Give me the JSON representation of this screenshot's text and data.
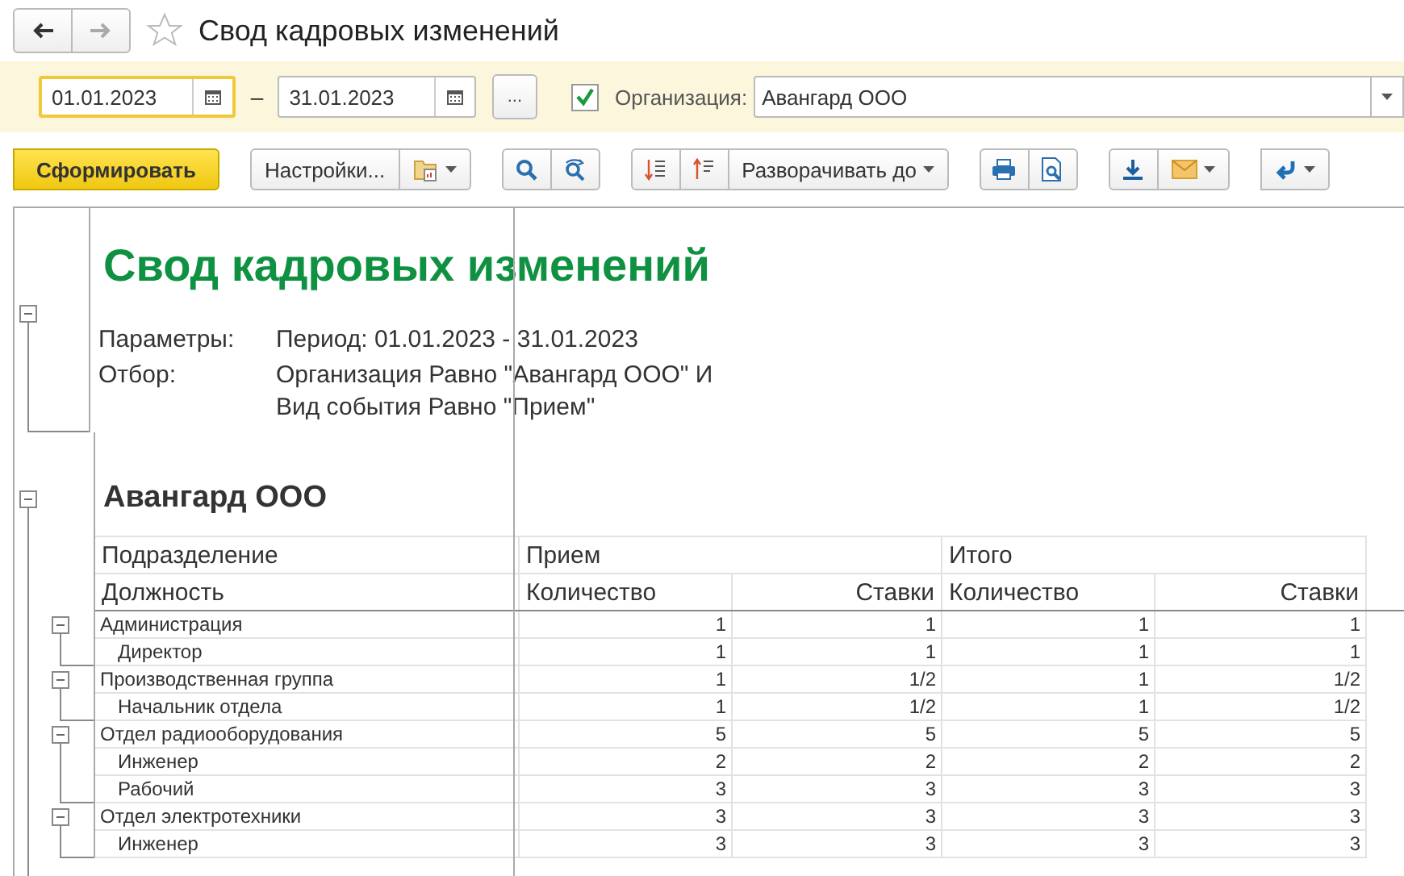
{
  "navigation": [
    {
      "kind": "back",
      "disabled": false
    },
    {
      "kind": "forward",
      "disabled": true
    }
  ],
  "favorite": false,
  "window": {
    "title": "Свод кадровых изменений"
  },
  "filters": {
    "date_from": {
      "value": "01.01.2023",
      "focused": true
    },
    "separator": "–",
    "date_to": {
      "value": "31.01.2023",
      "focused": false
    },
    "period_button": "...",
    "organization": {
      "checked": true,
      "label": "Организация:",
      "value": "Авангард ООО"
    }
  },
  "toolbar": {
    "generate_button": "Сформировать",
    "settings_button": "Настройки...",
    "expand_button": "Разворачивать до"
  },
  "report": {
    "title": "Свод кадровых изменений",
    "expanded": true,
    "parameters": [
      {
        "label": "Параметры:",
        "value": "Период: 01.01.2023 - 31.01.2023"
      },
      {
        "label": "Отбор:",
        "value": "Организация Равно \"Авангард ООО\" И\nВид события Равно \"Прием\""
      }
    ],
    "group": {
      "title": "Авангард ООО",
      "expanded": true,
      "header_row_1": [
        "Подразделение",
        "Прием",
        "Итого"
      ],
      "header_row_2": [
        "Должность",
        "Количество",
        "Ставки",
        "Количество",
        "Ставки"
      ],
      "rows": [
        {
          "name": "Администрация",
          "expanded": true,
          "values": [
            "1",
            "1",
            "1",
            "1"
          ],
          "children": [
            {
              "name": "Директор",
              "values": [
                "1",
                "1",
                "1",
                "1"
              ]
            }
          ]
        },
        {
          "name": "Производственная группа",
          "expanded": true,
          "values": [
            "1",
            "1/2",
            "1",
            "1/2"
          ],
          "children": [
            {
              "name": "Начальник отдела",
              "values": [
                "1",
                "1/2",
                "1",
                "1/2"
              ]
            }
          ]
        },
        {
          "name": "Отдел радиооборудования",
          "expanded": true,
          "values": [
            "5",
            "5",
            "5",
            "5"
          ],
          "children": [
            {
              "name": "Инженер",
              "values": [
                "2",
                "2",
                "2",
                "2"
              ]
            },
            {
              "name": "Рабочий",
              "values": [
                "3",
                "3",
                "3",
                "3"
              ]
            }
          ]
        },
        {
          "name": "Отдел электротехники",
          "expanded": true,
          "values": [
            "3",
            "3",
            "3",
            "3"
          ],
          "children": [
            {
              "name": "Инженер",
              "values": [
                "3",
                "3",
                "3",
                "3"
              ]
            }
          ]
        }
      ]
    }
  }
}
